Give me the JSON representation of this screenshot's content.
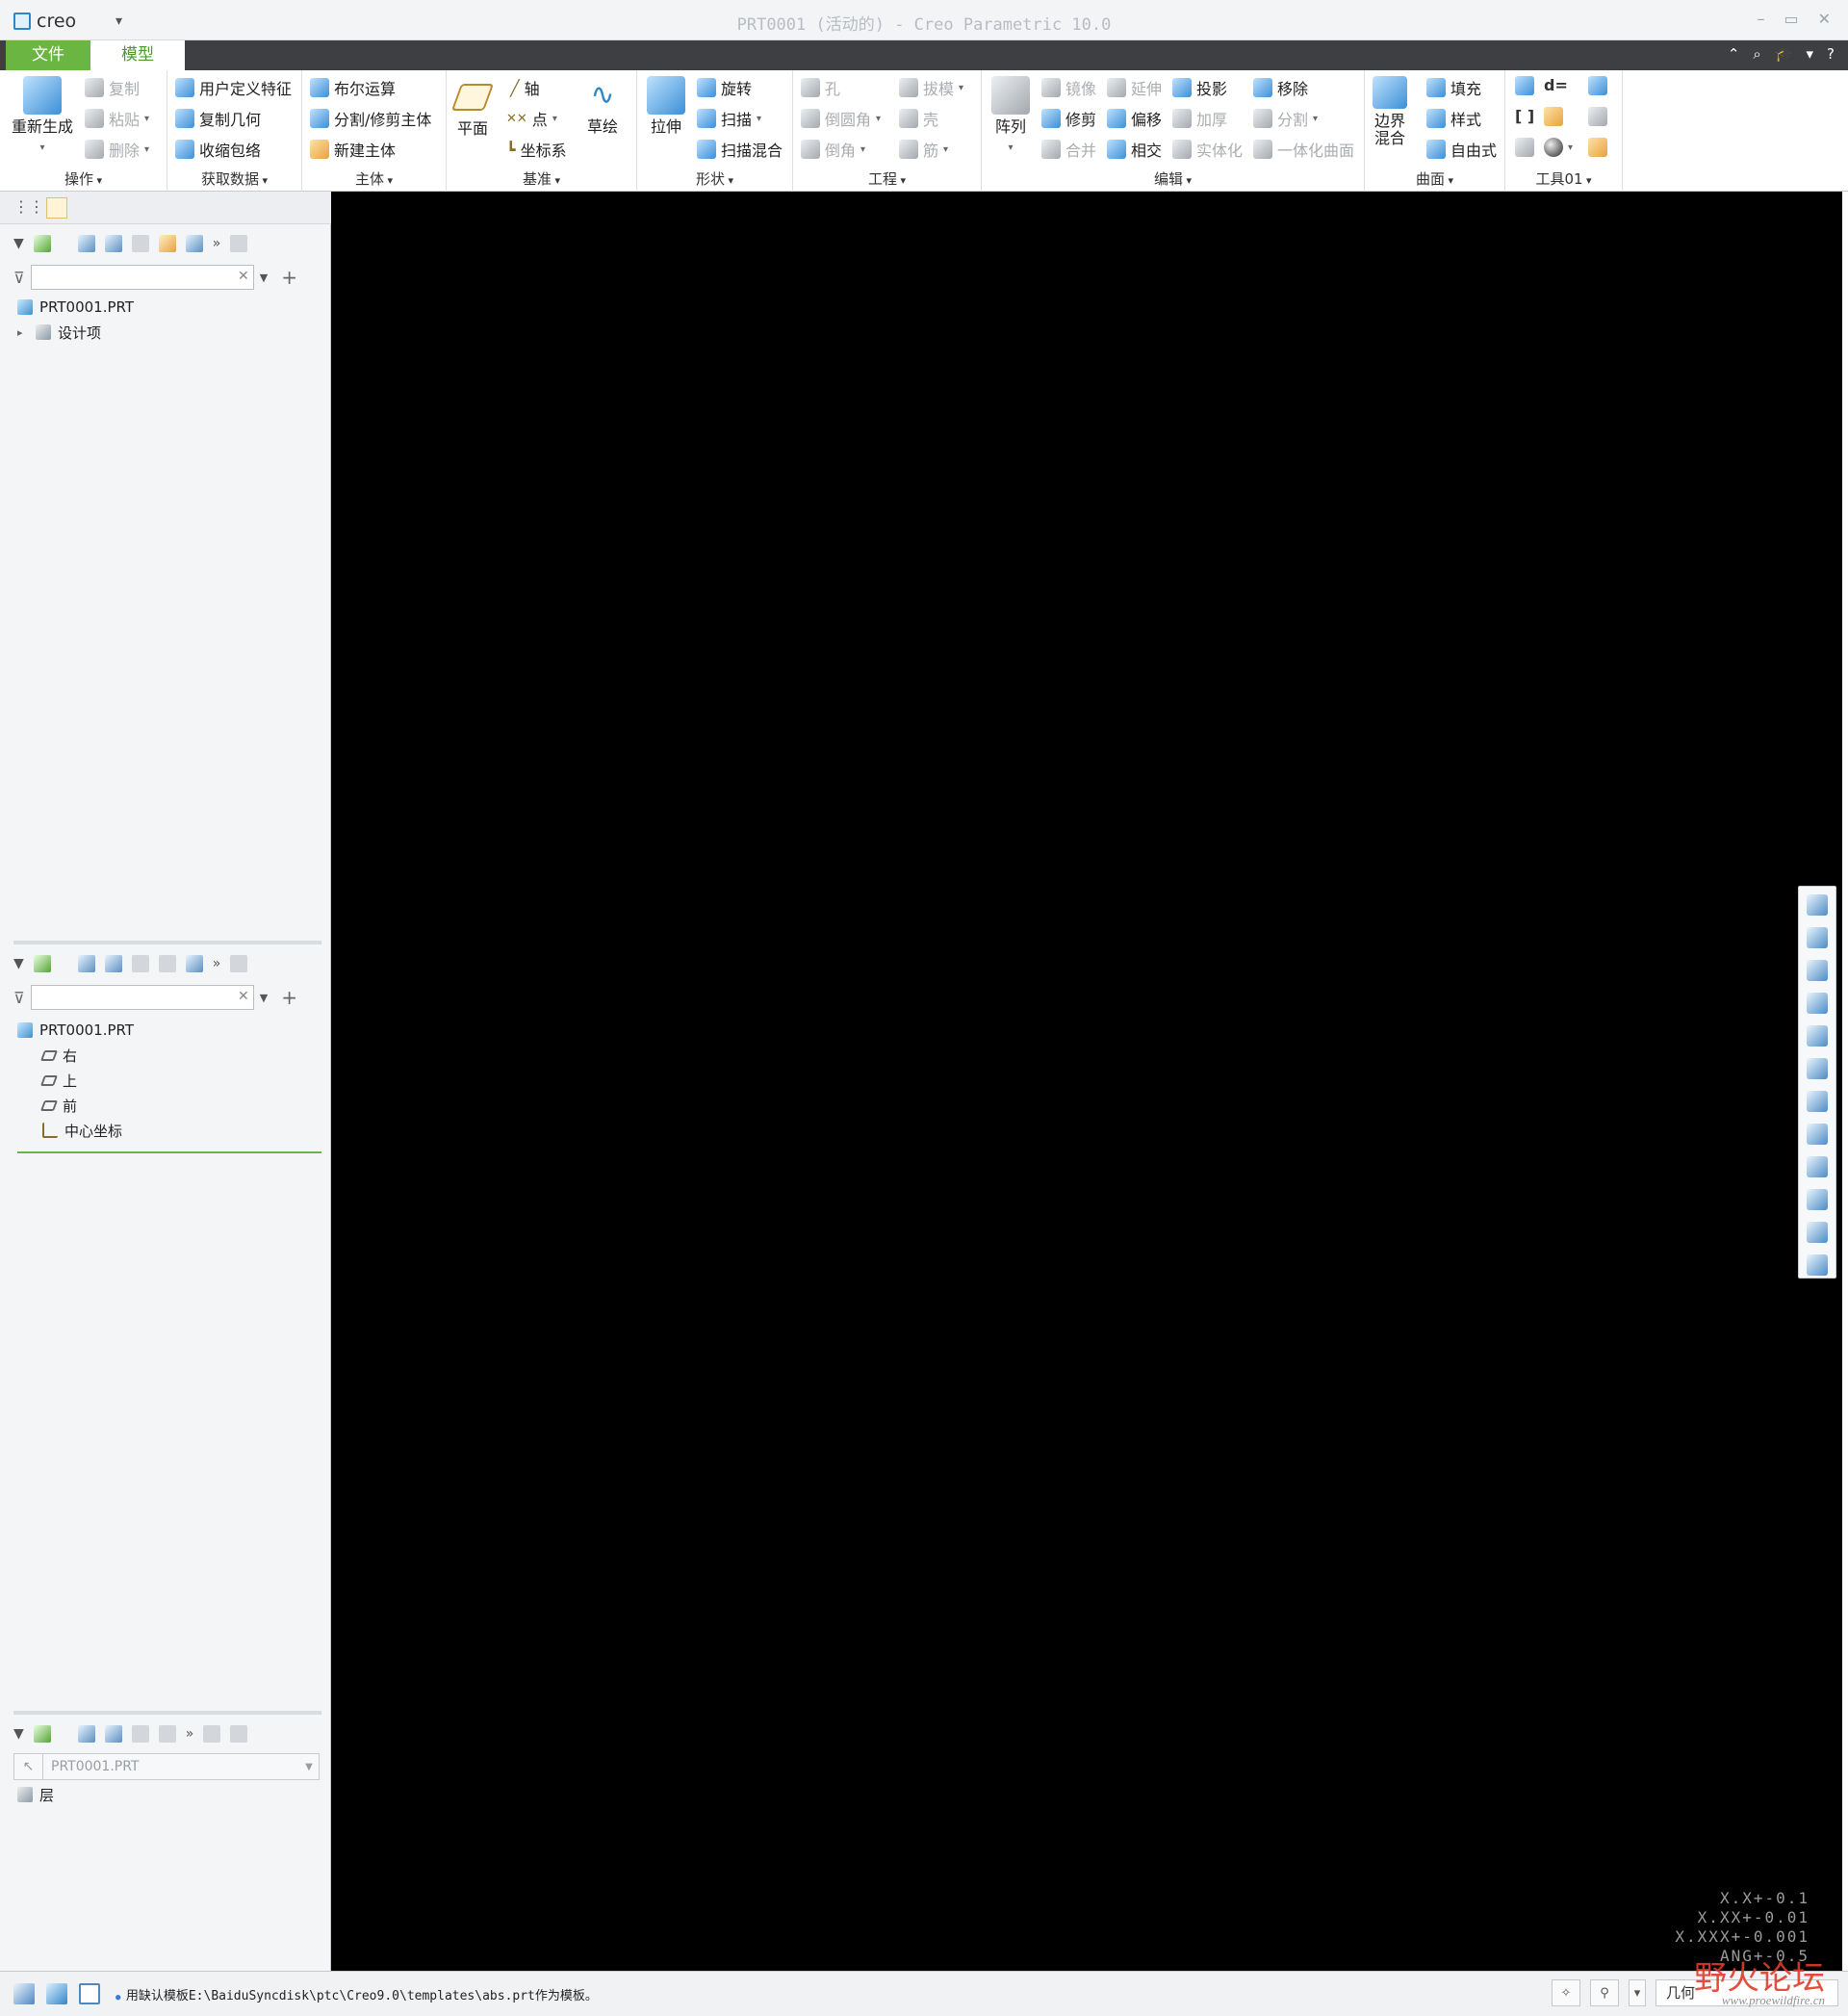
{
  "window": {
    "app_name": "creo",
    "title": "PRT0001 (活动的) - Creo Parametric 10.0"
  },
  "tabs": [
    {
      "label": "文件"
    },
    {
      "label": "模型"
    }
  ],
  "ribbon": {
    "ops": {
      "label": "操作",
      "regen": "重新生成",
      "copy": "复制",
      "paste": "粘贴",
      "delete": "删除"
    },
    "getdata": {
      "label": "获取数据",
      "udf": "用户定义特征",
      "copygeom": "复制几何",
      "shrinkwrap": "收缩包络"
    },
    "body": {
      "label": "主体",
      "boolean": "布尔运算",
      "split": "分割/修剪主体",
      "newbody": "新建主体"
    },
    "datum": {
      "label": "基准",
      "plane": "平面",
      "axis": "轴",
      "point": "点",
      "csys": "坐标系",
      "sketch": "草绘"
    },
    "shape": {
      "label": "形状",
      "extrude": "拉伸",
      "revolve": "旋转",
      "sweep": "扫描",
      "swept_blend": "扫描混合"
    },
    "engineering": {
      "label": "工程",
      "hole": "孔",
      "round": "倒圆角",
      "chamfer": "倒角",
      "draft": "拔模",
      "shell": "壳",
      "rib": "筋"
    },
    "editing": {
      "label": "编辑",
      "pattern": "阵列",
      "mirror": "镜像",
      "extend": "延伸",
      "project": "投影",
      "remove": "移除",
      "trim": "修剪",
      "offset": "偏移",
      "thicken": "加厚",
      "split": "分割",
      "merge": "合并",
      "intersect": "相交",
      "solidify": "实体化",
      "unify": "一体化曲面"
    },
    "surfaces": {
      "label": "曲面",
      "boundary_blend": "边界混合",
      "fill": "填充",
      "style": "样式",
      "freestyle": "自由式"
    },
    "tools": {
      "label": "工具01",
      "relations": "d="
    }
  },
  "model_tree": {
    "root": "PRT0001.PRT",
    "items": [
      "设计项"
    ]
  },
  "datum_tree": {
    "root": "PRT0001.PRT",
    "items": [
      "右",
      "上",
      "前",
      "中心坐标"
    ]
  },
  "layer_tree": {
    "selector": "PRT0001.PRT",
    "item": "层"
  },
  "tolerance": [
    "X.X+-0.1",
    "X.XX+-0.01",
    "X.XXX+-0.001",
    "ANG+-0.5"
  ],
  "status": {
    "message": "用缺认模板E:\\BaiduSyncdisk\\ptc\\Creo9.0\\templates\\abs.prt作为模板。",
    "filter": "几何"
  },
  "watermark": {
    "cn": "野火论坛",
    "url": "www.proewildfire.cn"
  },
  "colors": {
    "accent": "#6bb643",
    "ribbon_bg": "#ffffff",
    "viewport": "#000000",
    "tabbar": "#3d3f42"
  }
}
